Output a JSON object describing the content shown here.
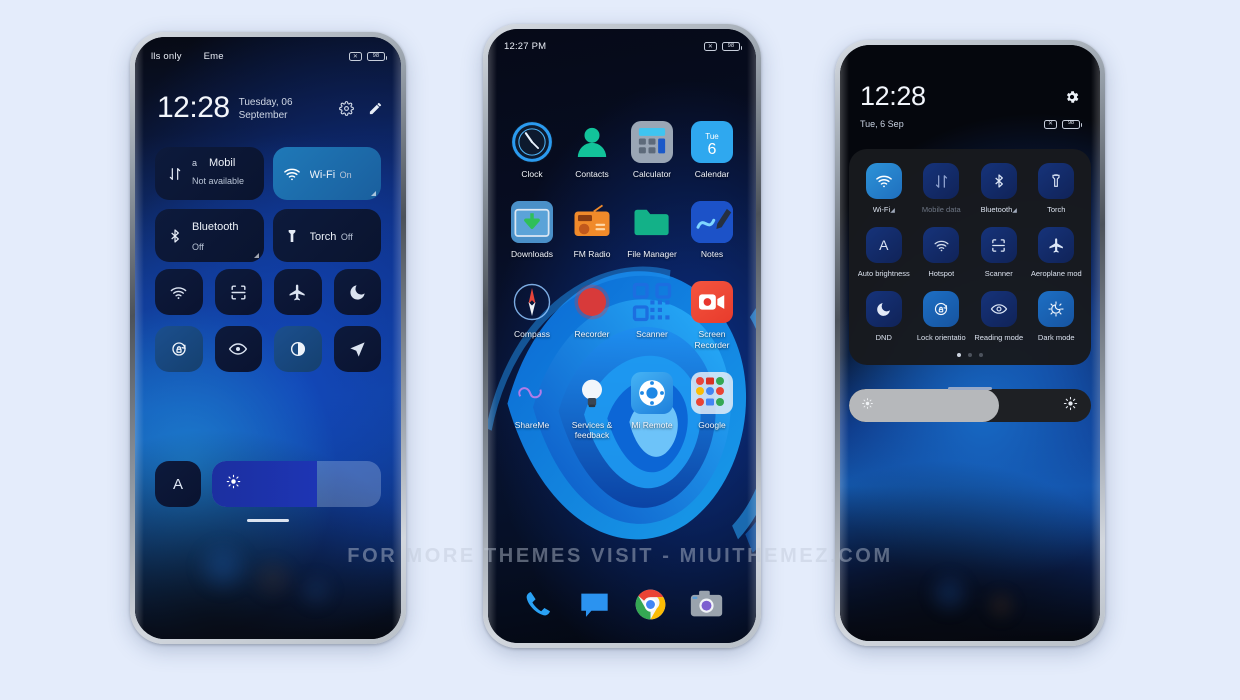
{
  "watermark": "FOR MORE THEMES VISIT - MIUITHEMEZ.COM",
  "phone_left": {
    "statusbar": {
      "carrier": "lls only",
      "emergency": "Eme",
      "silent_icon": "silent-mode-icon",
      "battery": "98"
    },
    "clock": {
      "time": "12:28",
      "date": "Tuesday, 06 September"
    },
    "actions": {
      "settings": "gear-icon",
      "edit": "pencil-icon"
    },
    "big_tiles": [
      {
        "name": "mobile-data",
        "prefix": "a",
        "title": "Mobil",
        "sub": "Not available",
        "state": "off",
        "icon": "mobile-data-icon",
        "expandable": false
      },
      {
        "name": "wifi",
        "title": "Wi-Fi",
        "sub": "On",
        "state": "on",
        "icon": "wifi-icon",
        "expandable": true
      },
      {
        "name": "bluetooth",
        "title": "Bluetooth",
        "sub": "Off",
        "state": "off",
        "icon": "bluetooth-icon",
        "expandable": true
      },
      {
        "name": "torch",
        "title": "Torch",
        "sub": "Off",
        "state": "off",
        "icon": "torch-icon",
        "expandable": false
      }
    ],
    "small_tiles": [
      {
        "name": "hotspot",
        "icon": "hotspot-icon",
        "lit": false
      },
      {
        "name": "scanner",
        "icon": "scanner-icon",
        "lit": false
      },
      {
        "name": "aeroplane-mode",
        "icon": "aeroplane-icon",
        "lit": false
      },
      {
        "name": "dnd",
        "icon": "moon-icon",
        "lit": false
      },
      {
        "name": "lock-orientation",
        "icon": "lock-rotation-icon",
        "lit": true
      },
      {
        "name": "reading-mode",
        "icon": "eye-icon",
        "lit": false
      },
      {
        "name": "dark-mode",
        "icon": "contrast-icon",
        "lit": true
      },
      {
        "name": "location",
        "icon": "location-arrow-icon",
        "lit": false
      }
    ],
    "brightness": {
      "auto_label": "A",
      "icon": "brightness-icon",
      "level": 62
    }
  },
  "phone_middle": {
    "statusbar": {
      "time": "12:27 PM",
      "silent_icon": "silent-mode-icon",
      "battery": "98"
    },
    "apps": [
      {
        "name": "clock",
        "label": "Clock",
        "icon": "clock-icon"
      },
      {
        "name": "contacts",
        "label": "Contacts",
        "icon": "contacts-icon"
      },
      {
        "name": "calculator",
        "label": "Calculator",
        "icon": "calculator-icon"
      },
      {
        "name": "calendar",
        "label": "Calendar",
        "icon": "calendar-icon",
        "day_name": "Tue",
        "day_num": "6"
      },
      {
        "name": "downloads",
        "label": "Downloads",
        "icon": "downloads-icon"
      },
      {
        "name": "fm-radio",
        "label": "FM Radio",
        "icon": "radio-icon"
      },
      {
        "name": "file-manager",
        "label": "File Manager",
        "icon": "folder-icon"
      },
      {
        "name": "notes",
        "label": "Notes",
        "icon": "notes-icon"
      },
      {
        "name": "compass",
        "label": "Compass",
        "icon": "compass-icon"
      },
      {
        "name": "recorder",
        "label": "Recorder",
        "icon": "recorder-icon"
      },
      {
        "name": "scanner",
        "label": "Scanner",
        "icon": "qr-scanner-icon"
      },
      {
        "name": "screen-recorder",
        "label": "Screen Recorder",
        "icon": "screen-recorder-icon"
      },
      {
        "name": "shareme",
        "label": "ShareMe",
        "icon": "shareme-icon"
      },
      {
        "name": "services-feedback",
        "label": "Services & feedback",
        "icon": "lightbulb-icon"
      },
      {
        "name": "mi-remote",
        "label": "Mi Remote",
        "icon": "remote-icon"
      },
      {
        "name": "google",
        "label": "Google",
        "icon": "google-folder-icon"
      }
    ],
    "dock": [
      {
        "name": "phone",
        "icon": "phone-icon"
      },
      {
        "name": "messages",
        "icon": "message-icon"
      },
      {
        "name": "chrome",
        "icon": "chrome-icon"
      },
      {
        "name": "camera",
        "icon": "camera-icon"
      }
    ]
  },
  "phone_right": {
    "header": {
      "time": "12:28",
      "date": "Tue, 6 Sep",
      "settings_icon": "gear-icon",
      "silent_icon": "silent-mode-icon",
      "battery": "98"
    },
    "quick_settings": [
      {
        "name": "wifi",
        "label": "Wi-Fi",
        "arrow": "◢",
        "state": "active",
        "icon": "wifi-icon"
      },
      {
        "name": "mobile-data",
        "label": "Mobile data",
        "state": "disabled",
        "icon": "mobile-data-icon"
      },
      {
        "name": "bluetooth",
        "label": "Bluetooth",
        "arrow": "◢",
        "state": "off",
        "icon": "bluetooth-icon"
      },
      {
        "name": "torch",
        "label": "Torch",
        "state": "off",
        "icon": "torch-icon"
      },
      {
        "name": "auto-brightness",
        "label": "Auto brightness",
        "state": "off",
        "icon": "auto-brightness-icon"
      },
      {
        "name": "hotspot",
        "label": "Hotspot",
        "state": "off",
        "icon": "hotspot-icon"
      },
      {
        "name": "scanner",
        "label": "Scanner",
        "state": "off",
        "icon": "scanner-icon"
      },
      {
        "name": "aeroplane-mode",
        "label": "Aeroplane mod",
        "state": "off",
        "icon": "aeroplane-icon"
      },
      {
        "name": "dnd",
        "label": "DND",
        "state": "off",
        "icon": "moon-icon"
      },
      {
        "name": "lock-orientation",
        "label": "Lock orientatio",
        "state": "accent",
        "icon": "lock-rotation-icon"
      },
      {
        "name": "reading-mode",
        "label": "Reading mode",
        "state": "off",
        "icon": "reading-mode-icon"
      },
      {
        "name": "dark-mode",
        "label": "Dark mode",
        "state": "accent",
        "icon": "dark-mode-icon"
      }
    ],
    "pages": {
      "total": 3,
      "current": 1
    },
    "brightness": {
      "level": 62,
      "left_icon": "auto-brightness-icon",
      "right_icon": "brightness-icon"
    }
  },
  "colors": {
    "page_background": "#e4ecfb",
    "accent_blue": "#1f79b8",
    "tile_dark": "#0d1a3c",
    "panel_dark": "#181a1e"
  }
}
